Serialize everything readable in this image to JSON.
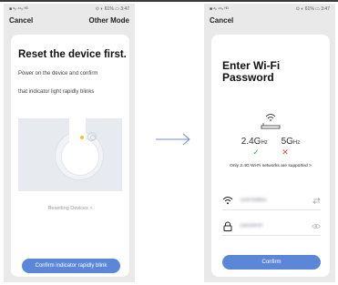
{
  "left_screen": {
    "status_left": "■ ᵃᵢₗ ⁴⁶ₗₗ ᴴᴰ",
    "status_right": "⊙ ◐ 61% ▭ 3:47",
    "nav_left": "Cancel",
    "nav_right": "Other Mode",
    "title": "Reset the device first.",
    "desc_line1": "Power on the device and confirm",
    "desc_line2": "that indicator light rapidly blinks",
    "resetting_link": "Resetting Devices >",
    "confirm_button": "Confirm indicator rapidly blink"
  },
  "right_screen": {
    "status_left": "■ ᵃᵢₗ ⁴⁶ₗₗ ᴴᴰ",
    "status_right": "⊙ ◐ 61% ▭ 3:47",
    "nav_left": "Cancel",
    "title_line1": "Enter Wi-Fi",
    "title_line2": "Password",
    "band_24_main": "2.4G",
    "band_24_unit": "Hz",
    "band_5_main": "5G",
    "band_5_unit": "Hz",
    "check_mark": "✓",
    "cross_mark": "✕",
    "support_note": "Only 2.4G Wi-Fi networks are supported >",
    "wifi_name_value": "ssid-hidden",
    "password_value": "password",
    "confirm_button": "Confirm"
  },
  "icons": {
    "arrow": "right-arrow-icon",
    "router": "router-icon",
    "wifi": "wifi-icon",
    "lock": "lock-icon",
    "swap": "swap-icon",
    "eye": "eye-icon"
  },
  "colors": {
    "accent": "#5c87d9",
    "check": "#3bb54a",
    "cross": "#e04545",
    "indicator": "#f4c42a"
  }
}
